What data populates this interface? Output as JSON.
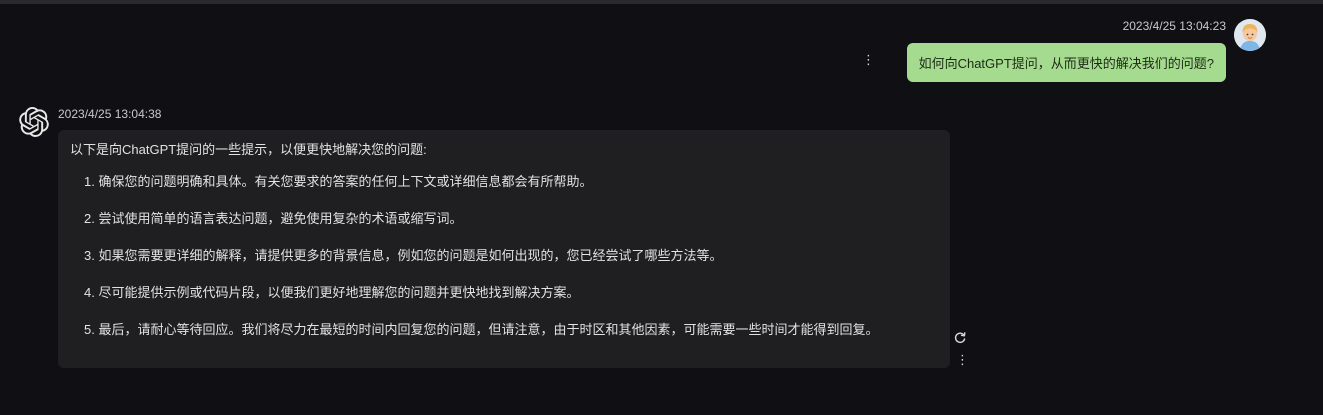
{
  "user_message": {
    "timestamp": "2023/4/25 13:04:23",
    "text": "如何向ChatGPT提问，从而更快的解决我们的问题?",
    "avatar_icon": "user-avatar-icon",
    "bubble_color": "#a5db8f",
    "more_icon": "⋮"
  },
  "bot_message": {
    "timestamp": "2023/4/25 13:04:38",
    "avatar_icon": "openai-logo-icon",
    "intro": "以下是向ChatGPT提问的一些提示，以便更快地解决您的问题:",
    "items": [
      {
        "label": "1. 确保您的问题明确和具体。有关您要求的答案的任何上下文或详细信息都会有所帮助。"
      },
      {
        "label": "2. 尝试使用简单的语言表达问题，避免使用复杂的术语或缩写词。"
      },
      {
        "label": "3. 如果您需要更详细的解释，请提供更多的背景信息，例如您的问题是如何出现的，您已经尝试了哪些方法等。"
      },
      {
        "label": "4. 尽可能提供示例或代码片段，以便我们更好地理解您的问题并更快地找到解决方案。"
      },
      {
        "label": "5. 最后，请耐心等待回应。我们将尽力在最短的时间内回复您的问题，但请注意，由于时区和其他因素，可能需要一些时间才能得到回复。"
      }
    ],
    "bubble_color": "#1f1f22",
    "more_icon": "⋮",
    "refresh_icon": "refresh-icon"
  },
  "colors": {
    "background": "#101014",
    "timestamp": "#c8c8c8"
  }
}
